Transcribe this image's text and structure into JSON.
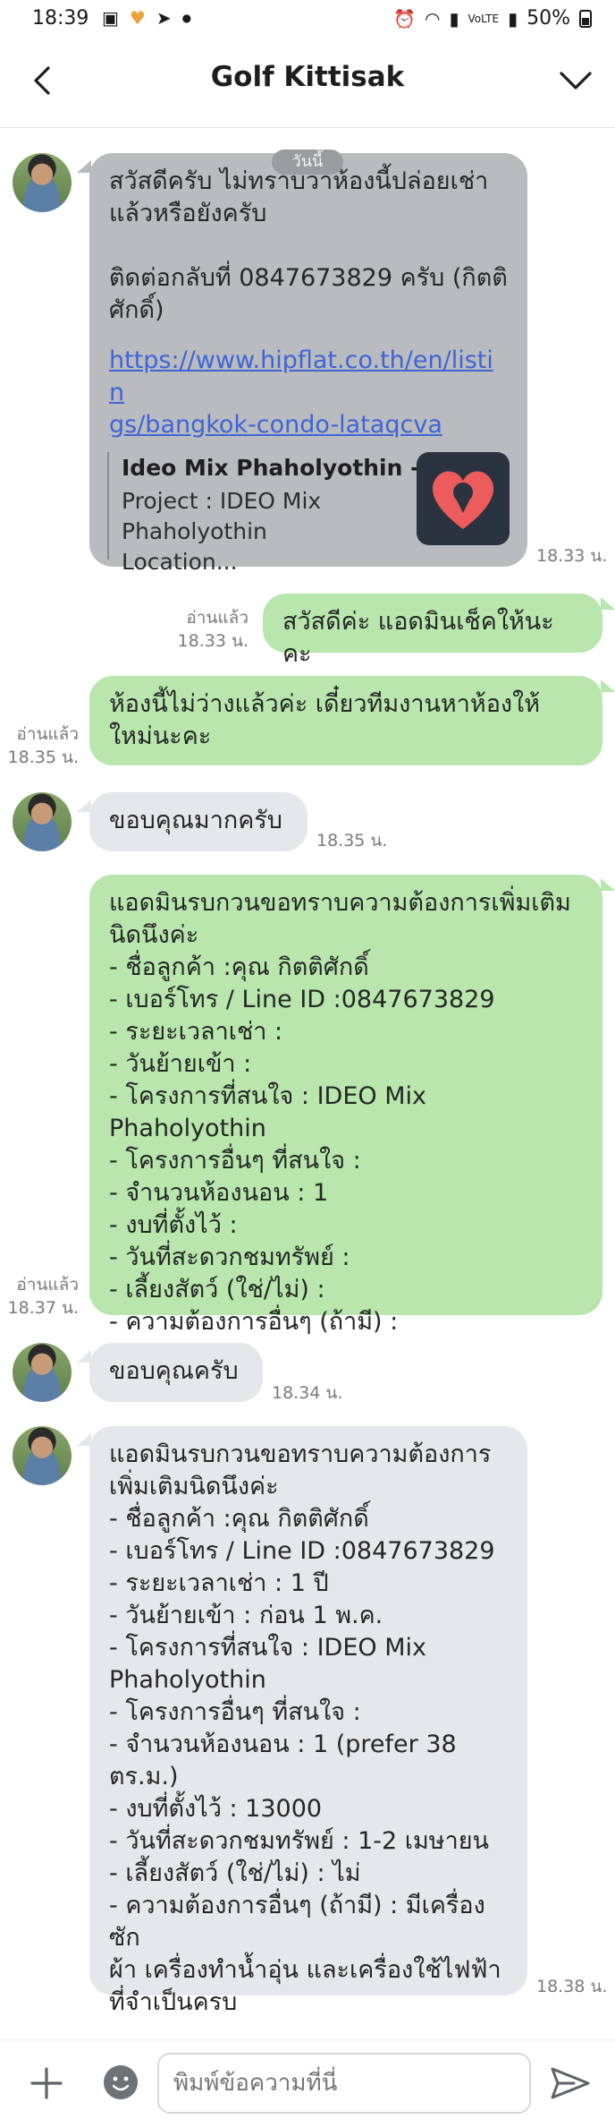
{
  "status_bar": {
    "time": "18:39",
    "battery": "50%",
    "left_icons": [
      "image-icon",
      "heart-app-icon",
      "send-icon",
      "dot-icon"
    ],
    "right_icons": [
      "alarm-icon",
      "wifi-icon",
      "signal-icon",
      "volte-icon",
      "signal-icon",
      "battery-icon"
    ]
  },
  "header": {
    "title": "Golf Kittisak"
  },
  "messages": [
    {
      "side": "in",
      "lines": [
        "สวัสดีครับ ไม่ทราบว่าห้องนี้ปล่อยเช่า",
        "แล้วหรือยังครับ",
        "",
        "ติดต่อกลับที่ 0847673829 ครับ (กิตติ",
        "ศักดิ์)"
      ],
      "link_lines": [
        "https://www.hipflat.co.th/en/listin",
        "gs/bangkok-condo-lataqcva"
      ],
      "preview": {
        "title": "Ideo Mix Phaholyothin - ...",
        "desc_lines": [
          "Project : IDEO Mix",
          "Phaholyothin Location..."
        ]
      },
      "date_pill": "วันนี้",
      "time": "18.33 น."
    },
    {
      "side": "out",
      "lines": [
        "สวัสดีค่ะ แอดมินเช็คให้นะคะ"
      ],
      "read": "อ่านแล้ว",
      "time": "18.33 น."
    },
    {
      "side": "out",
      "lines": [
        "ห้องนี้ไม่ว่างแล้วค่ะ เดี๋ยวทีมงานหาห้องให้",
        "ใหม่นะคะ"
      ],
      "read": "อ่านแล้ว",
      "time": "18.35 น."
    },
    {
      "side": "in",
      "lines": [
        "ขอบคุณมากครับ"
      ],
      "time": "18.35 น."
    },
    {
      "side": "out",
      "lines": [
        "แอดมินรบกวนขอทราบความต้องการเพิ่มเติม",
        "นิดนึงค่ะ",
        "- ชื่อลูกค้า :คุณ กิตติศักดิ์",
        "- เบอร์โทร / Line ID :0847673829",
        "- ระยะเวลาเช่า :",
        "- วันย้ายเข้า :",
        "- โครงการที่สนใจ : IDEO Mix Phaholyothin",
        "- โครงการอื่นๆ ที่สนใจ :",
        "- จำนวนห้องนอน : 1",
        "- งบที่ตั้งไว้ :",
        "- วันที่สะดวกชมทรัพย์ :",
        "- เลี้ยงสัตว์ (ใช่/ไม่) :",
        "- ความต้องการอื่นๆ (ถ้ามี) :"
      ],
      "read": "อ่านแล้ว",
      "time": "18.37 น."
    },
    {
      "side": "in",
      "lines": [
        "ขอบคุณครับ"
      ],
      "time": "18.34 น."
    },
    {
      "side": "in",
      "lines": [
        "แอดมินรบกวนขอทราบความต้องการ",
        "เพิ่มเติมนิดนึงค่ะ",
        "- ชื่อลูกค้า :คุณ กิตติศักดิ์",
        "- เบอร์โทร / Line ID :0847673829",
        "- ระยะเวลาเช่า : 1 ปี",
        "- วันย้ายเข้า : ก่อน 1 พ.ค.",
        "- โครงการที่สนใจ : IDEO Mix",
        "Phaholyothin",
        "- โครงการอื่นๆ ที่สนใจ :",
        "- จำนวนห้องนอน : 1 (prefer 38",
        "ตร.ม.)",
        "- งบที่ตั้งไว้ : 13000",
        "- วันที่สะดวกชมทรัพย์ : 1-2 เมษายน",
        "- เลี้ยงสัตว์ (ใช่/ไม่) : ไม่",
        "- ความต้องการอื่นๆ (ถ้ามี) : มีเครื่องซัก",
        "ผ้า เครื่องทำน้ำอุ่น และเครื่องใช้ไฟฟ้า",
        "ที่จำเป็นครบ"
      ],
      "time": "18.38 น."
    }
  ],
  "input_bar": {
    "placeholder": "พิมพ์ข้อความที่นี่"
  },
  "colors": {
    "incoming_bubble": "#e6e7ea",
    "incoming_bubble_selected": "#b9bbbf",
    "outgoing_bubble": "#b8e6ad",
    "link": "#3f64d6"
  }
}
